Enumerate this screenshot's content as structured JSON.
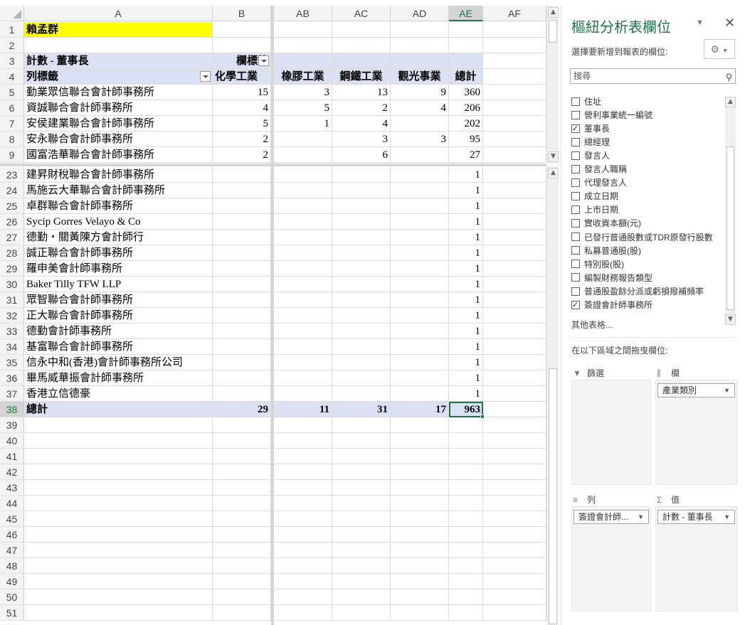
{
  "columns": [
    "A",
    "B",
    "AB",
    "AC",
    "AD",
    "AE",
    "AF"
  ],
  "rows_top": [
    {
      "n": "1",
      "a": "賴孟群"
    },
    {
      "n": "2"
    },
    {
      "n": "3",
      "a": "計數 - 董事長",
      "b": "欄標籤"
    },
    {
      "n": "4",
      "a": "列標籤",
      "b": "化學工業",
      "ab": "橡膠工業",
      "ac": "鋼鐵工業",
      "ad": "觀光事業",
      "ae": "總計"
    },
    {
      "n": "5",
      "a": "勤業眾信聯合會計師事務所",
      "b": "15",
      "ab": "3",
      "ac": "13",
      "ad": "9",
      "ae": "360"
    },
    {
      "n": "6",
      "a": "資誠聯合會計師事務所",
      "b": "4",
      "ab": "5",
      "ac": "2",
      "ad": "4",
      "ae": "206"
    },
    {
      "n": "7",
      "a": "安侯建業聯合會計師事務所",
      "b": "5",
      "ab": "1",
      "ac": "4",
      "ae": "202"
    },
    {
      "n": "8",
      "a": "安永聯合會計師事務所",
      "b": "2",
      "ac": "3",
      "ad": "3",
      "ae": "95"
    },
    {
      "n": "9",
      "a": "國富浩華聯合會計師事務所",
      "b": "2",
      "ac": "6",
      "ae": "27"
    }
  ],
  "rows_bottom": [
    {
      "n": "23",
      "a": "建昇財稅聯合會計師事務所",
      "ae": "1"
    },
    {
      "n": "24",
      "a": "馬施云大華聯合會計師事務所",
      "ae": "1"
    },
    {
      "n": "25",
      "a": "卓群聯合會計師事務所",
      "ae": "1"
    },
    {
      "n": "26",
      "a": "Sycip Gorres Velayo & Co",
      "ae": "1"
    },
    {
      "n": "27",
      "a": "德勤・關黃陳方會計師行",
      "ae": "1"
    },
    {
      "n": "28",
      "a": "誠正聯合會計師事務所",
      "ae": "1"
    },
    {
      "n": "29",
      "a": "羅申美會計師事務所",
      "ae": "1"
    },
    {
      "n": "30",
      "a": "Baker Tilly TFW LLP",
      "ae": "1"
    },
    {
      "n": "31",
      "a": "眾智聯合會計師事務所",
      "ae": "1"
    },
    {
      "n": "32",
      "a": "正大聯合會計師事務所",
      "ae": "1"
    },
    {
      "n": "33",
      "a": "德勤會計師事務所",
      "ae": "1"
    },
    {
      "n": "34",
      "a": "基富聯合會計師事務所",
      "ae": "1"
    },
    {
      "n": "35",
      "a": "信永中和(香港)會計師事務所公司",
      "ae": "1"
    },
    {
      "n": "36",
      "a": "畢馬威華振會計師事務所",
      "ae": "1"
    },
    {
      "n": "37",
      "a": "香港立信德豪",
      "ae": "1"
    },
    {
      "n": "38",
      "a": "總計",
      "b": "29",
      "ab": "11",
      "ac": "31",
      "ad": "17",
      "ae": "963"
    },
    {
      "n": "39"
    },
    {
      "n": "40"
    },
    {
      "n": "41"
    },
    {
      "n": "42"
    },
    {
      "n": "43"
    },
    {
      "n": "44"
    },
    {
      "n": "45"
    },
    {
      "n": "46"
    },
    {
      "n": "47"
    },
    {
      "n": "48"
    },
    {
      "n": "49"
    },
    {
      "n": "50"
    },
    {
      "n": "51"
    }
  ],
  "colors": {
    "accent": "#217346",
    "pivot_header": "#d9e1f2",
    "highlight": "#ffff00"
  },
  "panel": {
    "title": "樞紐分析表欄位",
    "subtitle": "選擇要新增到報表的欄位:",
    "search_placeholder": "搜尋",
    "fields": [
      {
        "label": "住址",
        "checked": false
      },
      {
        "label": "營利事業統一編號",
        "checked": false
      },
      {
        "label": "董事長",
        "checked": true
      },
      {
        "label": "總經理",
        "checked": false
      },
      {
        "label": "發言人",
        "checked": false
      },
      {
        "label": "發言人職稱",
        "checked": false
      },
      {
        "label": "代理發言人",
        "checked": false
      },
      {
        "label": "成立日期",
        "checked": false
      },
      {
        "label": "上市日期",
        "checked": false
      },
      {
        "label": "實收資本額(元)",
        "checked": false
      },
      {
        "label": "已發行普通股數或TDR原發行股數",
        "checked": false
      },
      {
        "label": "私募普通股(股)",
        "checked": false
      },
      {
        "label": "特別股(股)",
        "checked": false
      },
      {
        "label": "編製財務報告類型",
        "checked": false
      },
      {
        "label": "普通股盈餘分派或虧損撥補頻率",
        "checked": false
      },
      {
        "label": "簽證會計師事務所",
        "checked": true
      }
    ],
    "more_tables": "其他表格...",
    "drag_text": "在以下區域之間拖曳欄位:",
    "areas": {
      "filter_label": "篩選",
      "column_label": "欄",
      "column_item": "產業類別",
      "row_label": "列",
      "row_item": "簽證會計師...",
      "value_label": "值",
      "value_item": "計數 - 董事長"
    }
  }
}
